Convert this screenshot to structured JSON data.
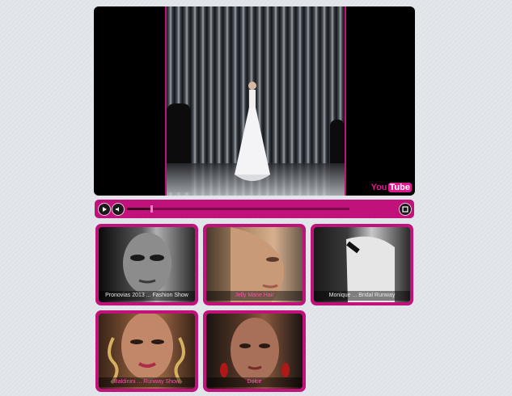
{
  "player": {
    "logo_you": "You",
    "logo_tube": "Tube",
    "accent": "#c0127a"
  },
  "controls": {
    "play_icon": "play-icon",
    "volume_icon": "volume-icon",
    "fullscreen_icon": "fullscreen-icon",
    "progress": 0.11
  },
  "thumbnails": [
    {
      "caption": "Pronovias 2013 ... Fashion Show",
      "caption_color": "#e8e8e8"
    },
    {
      "caption": "Jelly Mane Hair",
      "caption_color": "#ff4fb0"
    },
    {
      "caption": "Monique ... Bridal Runway",
      "caption_color": "#e8e8e8"
    },
    {
      "caption": "Baldinini ... Runway Show",
      "caption_color": "#ff4fb0"
    },
    {
      "caption": "Dolce",
      "caption_color": "#ff4fb0"
    }
  ]
}
